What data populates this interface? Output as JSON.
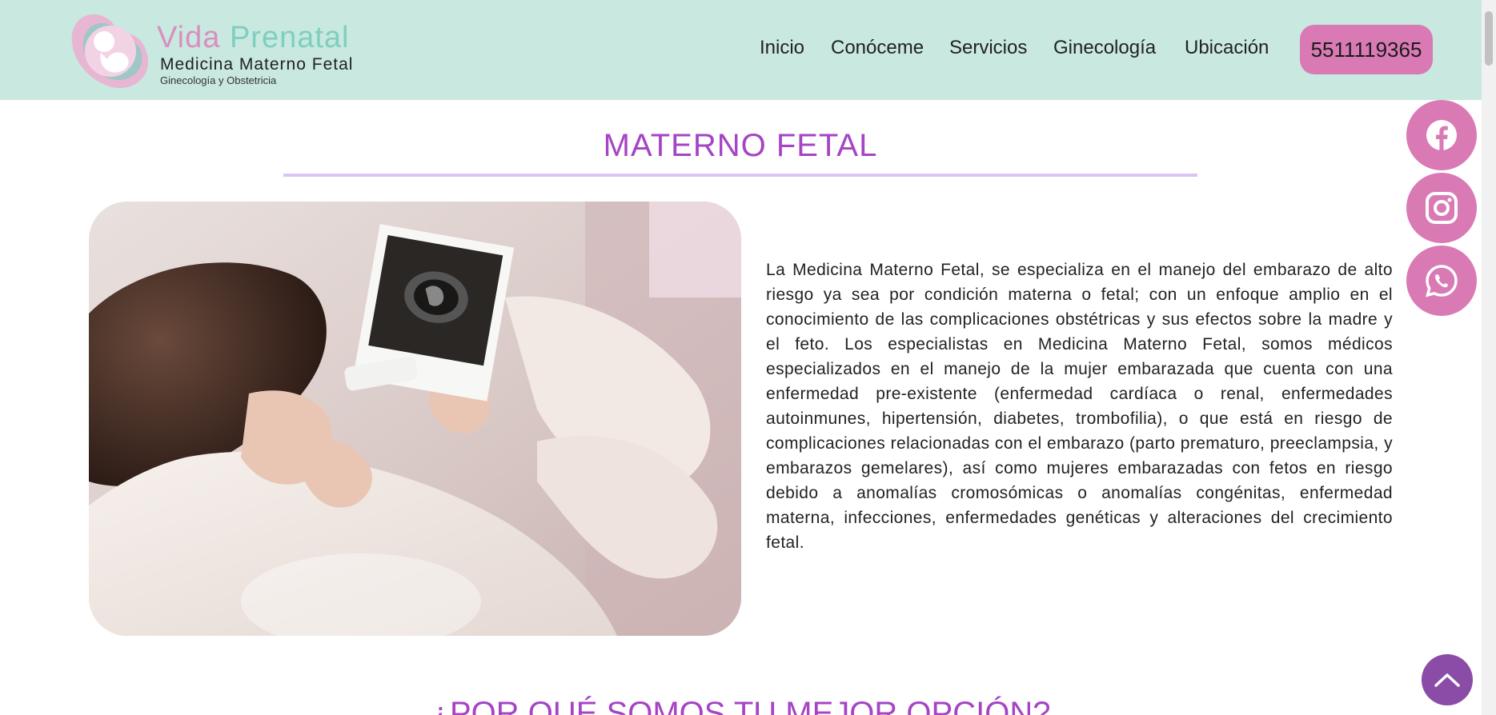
{
  "header": {
    "logo": {
      "title_part1": "Vida ",
      "title_part2": "Prenatal",
      "subtitle": "Medicina Materno Fetal",
      "tagline": "Ginecología y Obstetricia"
    },
    "nav": [
      {
        "label": "Inicio"
      },
      {
        "label": "Conóceme"
      },
      {
        "label": "Servicios"
      },
      {
        "label": "Ginecología"
      },
      {
        "label": "Ubicación"
      }
    ],
    "phone": "5511119365"
  },
  "social": [
    {
      "icon": "facebook-icon"
    },
    {
      "icon": "instagram-icon"
    },
    {
      "icon": "whatsapp-icon"
    }
  ],
  "main": {
    "section_title": "MATERNO FETAL",
    "description": "La Medicina Materno Fetal, se especializa en el manejo del embarazo de alto riesgo ya sea por condición materna o fetal; con un enfoque amplio en el conocimiento de las complicaciones obstétricas y sus efectos sobre la madre y el feto. Los especialistas en Medicina Materno Fetal, somos médicos especializados en el manejo de la mujer embarazada que cuenta con una enfermedad pre-existente (enfermedad cardíaca o renal, enfermedades autoinmunes, hipertensión, diabetes, trombofilia), o que está en riesgo de complicaciones relacionadas con el embarazo (parto prematuro, preeclampsia, y embarazos gemelares), así como mujeres embarazadas con fetos en riesgo debido a anomalías cromosómicas o anomalías congénitas, enfermedad materna, infecciones, enfermedades genéticas y alteraciones del crecimiento fetal.",
    "next_section_title": "¿POR QUÉ SOMOS TU MEJOR OPCIÓN?"
  },
  "colors": {
    "header_bg": "#c8e8e0",
    "accent_pink": "#d97ab5",
    "title_purple": "#a544c4",
    "rule_lavender": "#dcc3f3",
    "to_top": "#8a4ca6"
  }
}
